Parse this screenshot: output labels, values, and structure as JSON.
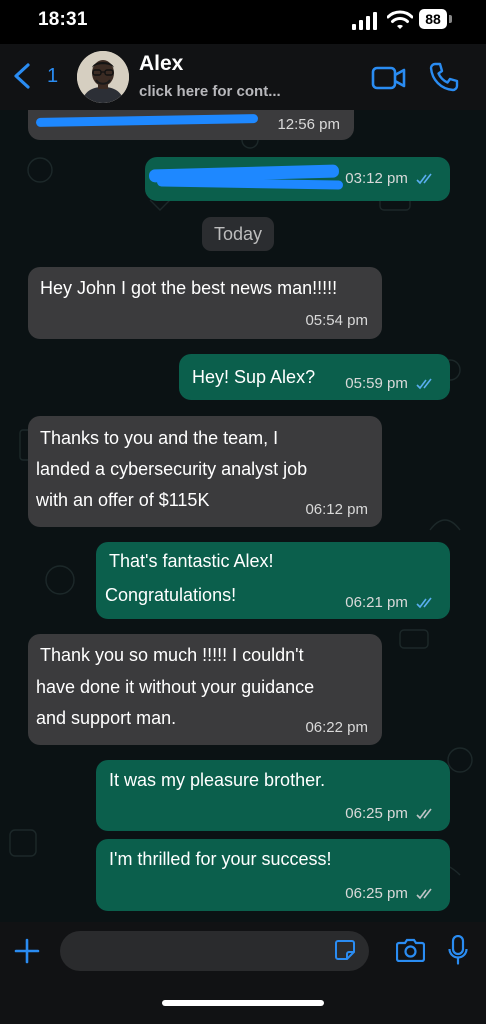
{
  "status_bar": {
    "time": "18:31",
    "battery": "88"
  },
  "header": {
    "back_count": "1",
    "contact_name": "Alex",
    "contact_subtitle": "click here for cont..."
  },
  "chat": {
    "day_separator": "Today",
    "messages": [
      {
        "direction": "in",
        "text_lines": [],
        "time": "12:56 pm",
        "redacted": true
      },
      {
        "direction": "out",
        "text_lines": [],
        "time": "03:12 pm",
        "redacted": true,
        "read": true
      },
      {
        "direction": "in",
        "text_lines": [
          "Hey John I got the best news man!!!!!"
        ],
        "time": "05:54 pm"
      },
      {
        "direction": "out",
        "text_lines": [
          "Hey! Sup Alex?"
        ],
        "time": "05:59 pm",
        "read": true
      },
      {
        "direction": "in",
        "text_lines": [
          "Thanks to you and the team, I",
          "landed a cybersecurity analyst job",
          "with an offer of $115K"
        ],
        "time": "06:12 pm"
      },
      {
        "direction": "out",
        "text_lines": [
          "That's fantastic Alex!",
          "Congratulations!"
        ],
        "time": "06:21 pm",
        "read": true
      },
      {
        "direction": "in",
        "text_lines": [
          "Thank you so much !!!!! I couldn't",
          "have done it without your guidance",
          "and support man."
        ],
        "time": "06:22 pm"
      },
      {
        "direction": "out",
        "text_lines": [
          "It was my pleasure brother."
        ],
        "time": "06:25 pm",
        "read": false
      },
      {
        "direction": "out",
        "text_lines": [
          "I'm thrilled for your success!"
        ],
        "time": "06:25 pm",
        "read": false
      }
    ]
  },
  "input": {
    "placeholder": ""
  },
  "colors": {
    "accent": "#2a8cf2",
    "incoming_bubble": "#3b3b3d",
    "outgoing_bubble": "#0b5f4c",
    "read_ticks": "#5aaef0",
    "delivered_ticks": "#bfc4c6"
  }
}
